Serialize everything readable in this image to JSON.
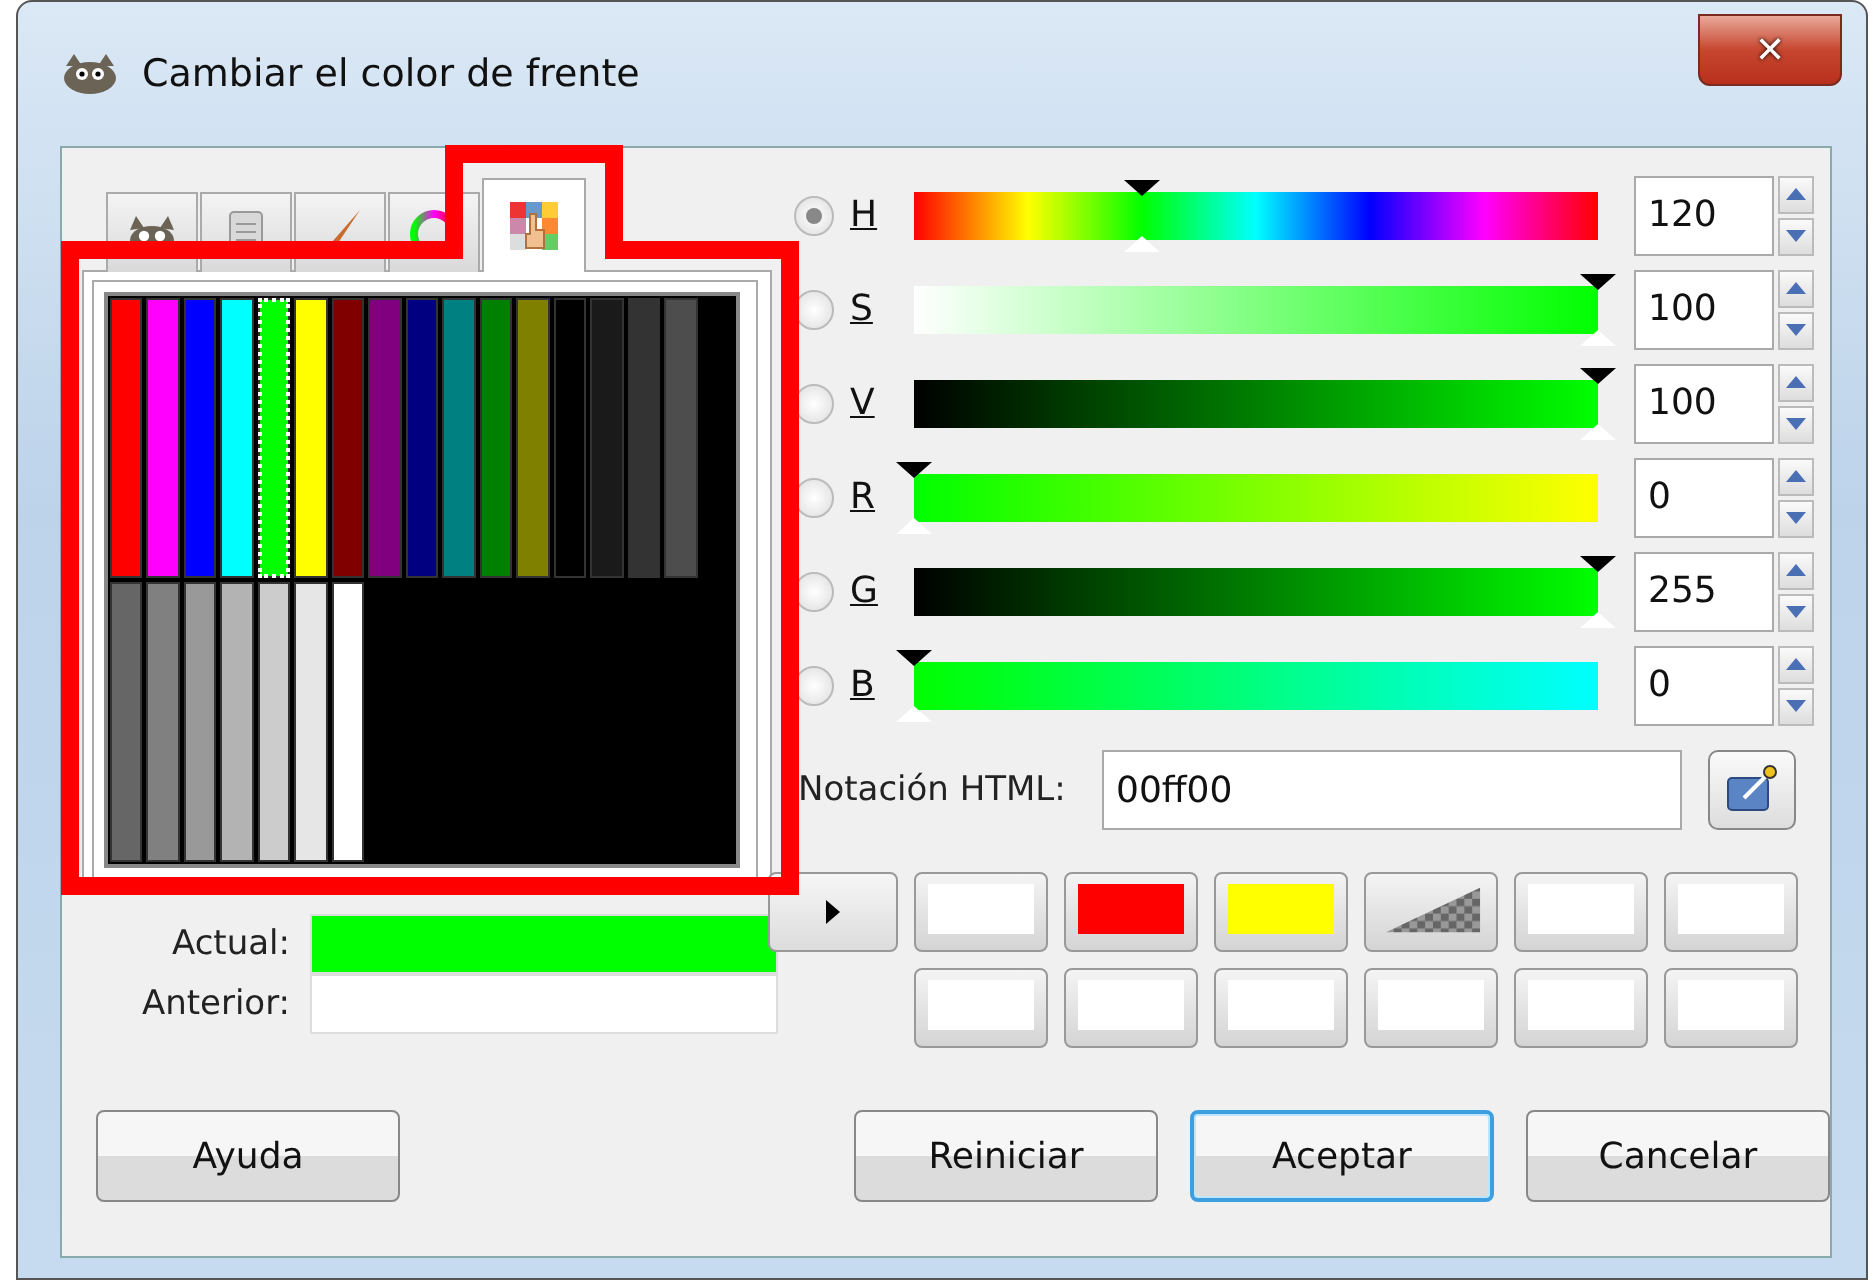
{
  "window": {
    "title": "Cambiar el color de frente",
    "close": "✕"
  },
  "tabs": [
    {
      "kind": "gimp",
      "selected": false
    },
    {
      "kind": "document",
      "selected": false
    },
    {
      "kind": "brush",
      "selected": false
    },
    {
      "kind": "wheel",
      "selected": false
    },
    {
      "kind": "palette",
      "selected": true
    }
  ],
  "palette": [
    {
      "color": "#ff0000",
      "selected": false
    },
    {
      "color": "#ff00ff",
      "selected": false
    },
    {
      "color": "#0000ff",
      "selected": false
    },
    {
      "color": "#00ffff",
      "selected": false
    },
    {
      "color": "#00ff00",
      "selected": true
    },
    {
      "color": "#ffff00",
      "selected": false
    },
    {
      "color": "#800000",
      "selected": false
    },
    {
      "color": "#800080",
      "selected": false
    },
    {
      "color": "#000080",
      "selected": false
    },
    {
      "color": "#008080",
      "selected": false
    },
    {
      "color": "#008000",
      "selected": false
    },
    {
      "color": "#808000",
      "selected": false
    },
    {
      "color": "#000000",
      "selected": false
    },
    {
      "color": "#1a1a1a",
      "selected": false
    },
    {
      "color": "#333333",
      "selected": false
    },
    {
      "color": "#4d4d4d",
      "selected": false
    },
    {
      "color": "#666666",
      "selected": false
    },
    {
      "color": "#808080",
      "selected": false
    },
    {
      "color": "#999999",
      "selected": false
    },
    {
      "color": "#b3b3b3",
      "selected": false
    },
    {
      "color": "#cccccc",
      "selected": false
    },
    {
      "color": "#e6e6e6",
      "selected": false
    },
    {
      "color": "#ffffff",
      "selected": false
    }
  ],
  "current": {
    "label": "Actual:",
    "color": "#00ff00"
  },
  "previous": {
    "label": "Anterior:",
    "color": "#ffffff"
  },
  "channels": [
    {
      "label": "H",
      "kind": "hue",
      "selected": true,
      "level": 0.333,
      "value": "120"
    },
    {
      "label": "S",
      "kind": "saturation",
      "selected": false,
      "level": 1,
      "value": "100"
    },
    {
      "label": "V",
      "kind": "value",
      "selected": false,
      "level": 1,
      "value": "100"
    },
    {
      "label": "R",
      "kind": "red",
      "selected": false,
      "level": 0,
      "value": "0"
    },
    {
      "label": "G",
      "kind": "green",
      "selected": false,
      "level": 1,
      "value": "255"
    },
    {
      "label": "B",
      "kind": "blue",
      "selected": false,
      "level": 0,
      "value": "0"
    }
  ],
  "html_notation": {
    "label": "Notación HTML:",
    "value": "00ff00"
  },
  "history": [
    {
      "kind": "color",
      "color": "#ffffff"
    },
    {
      "kind": "color",
      "color": "#ff0000"
    },
    {
      "kind": "color",
      "color": "#ffff00"
    },
    {
      "kind": "transparent"
    },
    {
      "kind": "color",
      "color": "#ffffff"
    },
    {
      "kind": "color",
      "color": "#ffffff"
    },
    {
      "kind": "color",
      "color": "#ffffff"
    },
    {
      "kind": "color",
      "color": "#ffffff"
    },
    {
      "kind": "color",
      "color": "#ffffff"
    },
    {
      "kind": "color",
      "color": "#ffffff"
    },
    {
      "kind": "color",
      "color": "#ffffff"
    },
    {
      "kind": "color",
      "color": "#ffffff"
    }
  ],
  "buttons": [
    {
      "label": "Ayuda",
      "selected": false
    },
    {
      "label": "Reiniciar",
      "selected": false
    },
    {
      "label": "Aceptar",
      "selected": true
    },
    {
      "label": "Cancelar",
      "selected": false
    }
  ]
}
